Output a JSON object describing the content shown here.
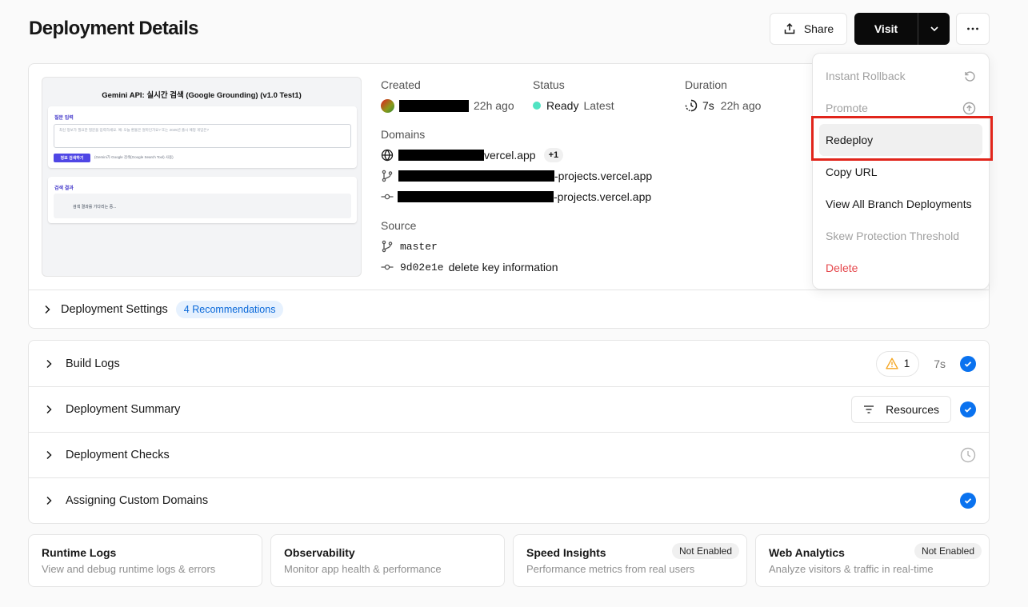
{
  "header": {
    "title": "Deployment Details",
    "share_label": "Share",
    "visit_label": "Visit"
  },
  "preview": {
    "title": "Gemini API: 실시간 검색 (Google Grounding) (v1.0 Test1)",
    "question_label": "질문 입력",
    "input_placeholder": "최신 정보가 필요한 질문을 입력하세요. 예: 오늘 환율은 얼마인가요? 또는 2025년 출시 예정 게임은?",
    "button_label": "정보 검색하기",
    "note": "(Gemini가 Google 검색(Google Search Tool) 사용)",
    "result_label": "검색 결과",
    "result_text": "검색 결과를 기다리는 중..."
  },
  "info": {
    "created_label": "Created",
    "created_time": "22h ago",
    "status_label": "Status",
    "status_value": "Ready",
    "status_tag": "Latest",
    "duration_label": "Duration",
    "duration_value": "7s",
    "duration_ago": "22h ago",
    "domains_label": "Domains",
    "domain_1": "vercel.app",
    "domain_more": "+1",
    "domain_2": "-projects.vercel.app",
    "domain_3": "-projects.vercel.app",
    "source_label": "Source",
    "branch": "master",
    "commit_hash": "9d02e1e",
    "commit_message": "delete key information"
  },
  "settings": {
    "label": "Deployment Settings",
    "badge": "4 Recommendations"
  },
  "logs": {
    "rows": [
      {
        "label": "Build Logs"
      },
      {
        "label": "Deployment Summary"
      },
      {
        "label": "Deployment Checks"
      },
      {
        "label": "Assigning Custom Domains"
      }
    ],
    "warning_count": "1",
    "build_duration": "7s",
    "resources_label": "Resources"
  },
  "cards": [
    {
      "title": "Runtime Logs",
      "subtitle": "View and debug runtime logs & errors"
    },
    {
      "title": "Observability",
      "subtitle": "Monitor app health & performance"
    },
    {
      "title": "Speed Insights",
      "subtitle": "Performance metrics from real users",
      "badge": "Not Enabled"
    },
    {
      "title": "Web Analytics",
      "subtitle": "Analyze visitors & traffic in real-time",
      "badge": "Not Enabled"
    }
  ],
  "menu": {
    "items": [
      {
        "label": "Instant Rollback",
        "icon": "rollback-icon"
      },
      {
        "label": "Promote",
        "icon": "promote-icon"
      },
      {
        "label": "Redeploy"
      },
      {
        "label": "Copy URL"
      },
      {
        "label": "View All Branch Deployments"
      },
      {
        "label": "Skew Protection Threshold"
      },
      {
        "label": "Delete"
      }
    ]
  },
  "colors": {
    "accent": "#0a72ef",
    "status_ready": "#50e3c2",
    "danger": "#e5484d",
    "highlight_box": "#e1251b"
  }
}
